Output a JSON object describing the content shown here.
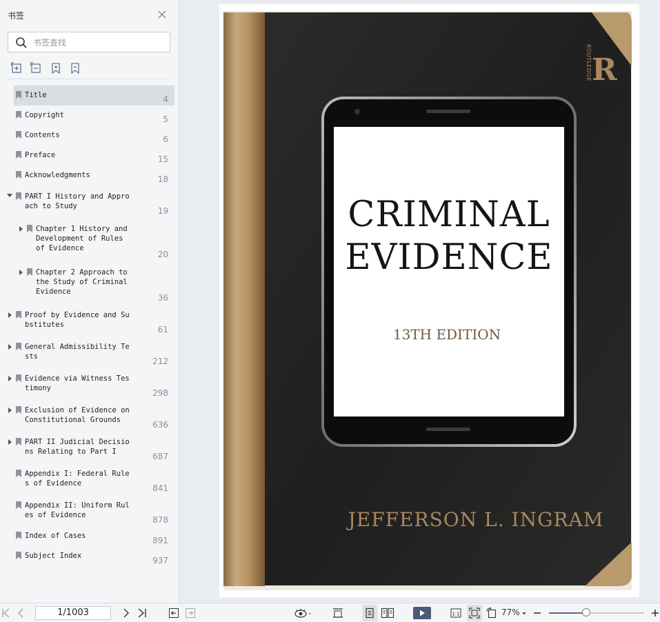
{
  "sidebar": {
    "title": "书签",
    "search_placeholder": "书签查找",
    "tools": [
      "expand-all-icon",
      "collapse-all-icon",
      "add-bookmark-icon",
      "bookmark-icon"
    ],
    "bookmarks": [
      {
        "label": "Title",
        "page": "4",
        "selected": true
      },
      {
        "label": "Copyright",
        "page": "5"
      },
      {
        "label": "Contents",
        "page": "6"
      },
      {
        "label": "Preface",
        "page": "15"
      },
      {
        "label": "Acknowledgments",
        "page": "18"
      },
      {
        "label": "PART I History and Appro\nach to Study",
        "page": "19",
        "expanded": true
      },
      {
        "label": "Chapter 1 History and\nDevelopment of Rules\nof Evidence",
        "page": "20"
      },
      {
        "label": "Chapter 2 Approach to\nthe Study of Criminal\nEvidence",
        "page": "36"
      },
      {
        "label": "Proof by Evidence and Su\nbstitutes",
        "page": "61"
      },
      {
        "label": "General Admissibility Te\nsts",
        "page": "212"
      },
      {
        "label": "Evidence via Witness Tes\ntimony",
        "page": "298"
      },
      {
        "label": "Exclusion of Evidence on\nConstitutional Grounds",
        "page": "636"
      },
      {
        "label": "PART II Judicial Decisio\nns Relating to Part I",
        "page": "687"
      },
      {
        "label": "Appendix I: Federal Rule\ns of Evidence",
        "page": "841"
      },
      {
        "label": "Appendix II: Uniform Rul\nes of Evidence",
        "page": "878"
      },
      {
        "label": "Index of Cases",
        "page": "891"
      },
      {
        "label": "Subject Index",
        "page": "937"
      }
    ]
  },
  "book": {
    "title_line1": "CRIMINAL",
    "title_line2": "EVIDENCE",
    "edition": "13TH EDITION",
    "author": "JEFFERSON L. INGRAM",
    "publisher": "ROUTLEDGE",
    "publisher_mark": "R"
  },
  "toolbar": {
    "page_value": "1/1003",
    "zoom": "77%",
    "zoom_level": 0.39
  }
}
